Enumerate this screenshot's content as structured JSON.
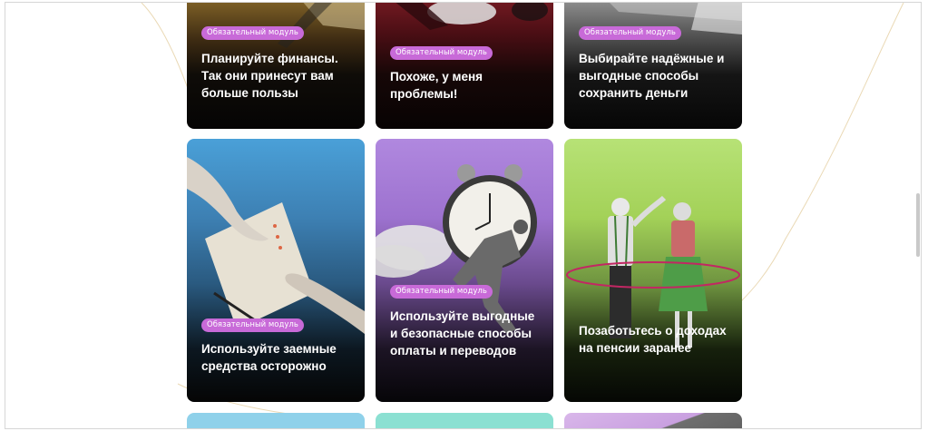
{
  "colors": {
    "badge": "#c86ad8",
    "title_text": "#ffffff",
    "page_bg": "#ffffff",
    "curve": "#ead9b5"
  },
  "cards": [
    {
      "badge": "Обязательный модуль",
      "title": "Планируйте финансы. Так они принесут вам больше пользы"
    },
    {
      "badge": "Обязательный модуль",
      "title": "Похоже, у меня проблемы!"
    },
    {
      "badge": "Обязательный модуль",
      "title": "Выбирайте надёжные и выгодные способы сохранить деньги"
    },
    {
      "badge": "Обязательный модуль",
      "title": "Используйте заемные средства осторожно",
      "art_icon": "hands-document-icon"
    },
    {
      "badge": "Обязательный модуль",
      "title": "Используйте выгодные и безопасные способы оплаты и переводов",
      "art_icon": "alarm-clock-runner-icon"
    },
    {
      "title": "Позаботьтесь о доходах на пенсии заранее",
      "art_icon": "elderly-couple-dancing-icon"
    },
    {},
    {},
    {}
  ]
}
